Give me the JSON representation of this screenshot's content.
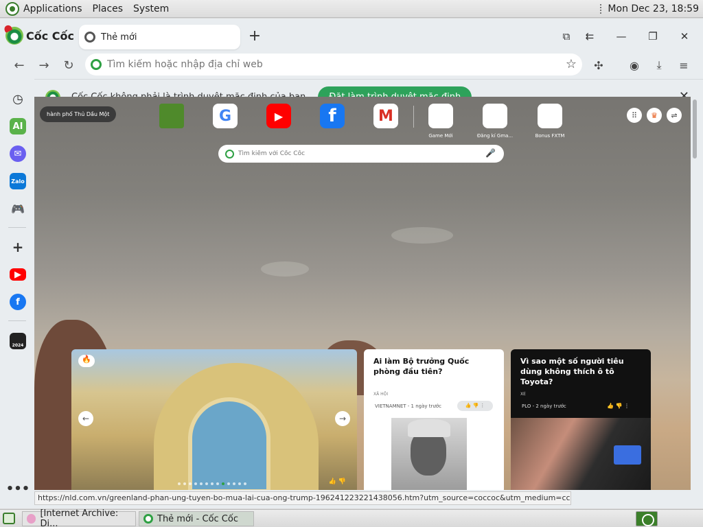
{
  "system_panel": {
    "menus": [
      "Applications",
      "Places",
      "System"
    ],
    "clock": "Mon Dec 23, 18:59"
  },
  "browser": {
    "brand": "Cốc Cốc",
    "tab_title": "Thẻ mới",
    "new_tab_symbol": "+",
    "omnibox_placeholder": "Tìm kiếm hoặc nhập địa chỉ web",
    "infobar": {
      "message": "Cốc Cốc không phải là trình duyệt mặc định của bạn",
      "action": "Đặt làm trình duyệt mặc định"
    },
    "sidebar": [
      "history-icon",
      "ai-icon",
      "messenger-icon",
      "zalo-icon",
      "game-icon",
      "add-icon",
      "youtube-icon",
      "facebook-icon",
      "coccoc-2024-icon",
      "more-icon"
    ],
    "sidebar_labels": {
      "ai": "AI",
      "zalo": "Zalo",
      "year": "2024"
    }
  },
  "newtab": {
    "location": "hành phố Thủ Dầu Một",
    "search_placeholder": "Tìm kiếm với Cốc Cốc",
    "shortcuts": [
      {
        "name": "",
        "icon": "green-square"
      },
      {
        "name": "",
        "icon": "google-icon",
        "glyph": "G"
      },
      {
        "name": "",
        "icon": "youtube-icon",
        "glyph": "▶"
      },
      {
        "name": "",
        "icon": "facebook-icon",
        "glyph": "f"
      },
      {
        "name": "",
        "icon": "gmail-icon",
        "glyph": "M"
      },
      {
        "name": "Game Mới",
        "icon": "blank"
      },
      {
        "name": "Đăng kí Gma...",
        "icon": "blank"
      },
      {
        "name": "Bonus FXTM",
        "icon": "blank"
      }
    ]
  },
  "news": {
    "article1": {
      "title": "Ai làm Bộ trưởng Quốc phòng đầu tiên?",
      "category": "XÃ HỘI",
      "source": "VIETNAMNET - 1 ngày trước"
    },
    "article2": {
      "title": "Vì sao một số người tiêu dùng không thích ô tô Toyota?",
      "category": "XE",
      "source": "PLO - 2 ngày trước"
    }
  },
  "status_url": "https://nld.com.vn/greenland-phan-ung-tuyen-bo-mua-lai-cua-ong-trump-196241223221438056.htm?utm_source=coccoc&utm_medium=ccnews",
  "taskbar": {
    "tasks": [
      "[Internet Archive: Di...",
      "Thẻ mới - Cốc Cốc"
    ]
  }
}
